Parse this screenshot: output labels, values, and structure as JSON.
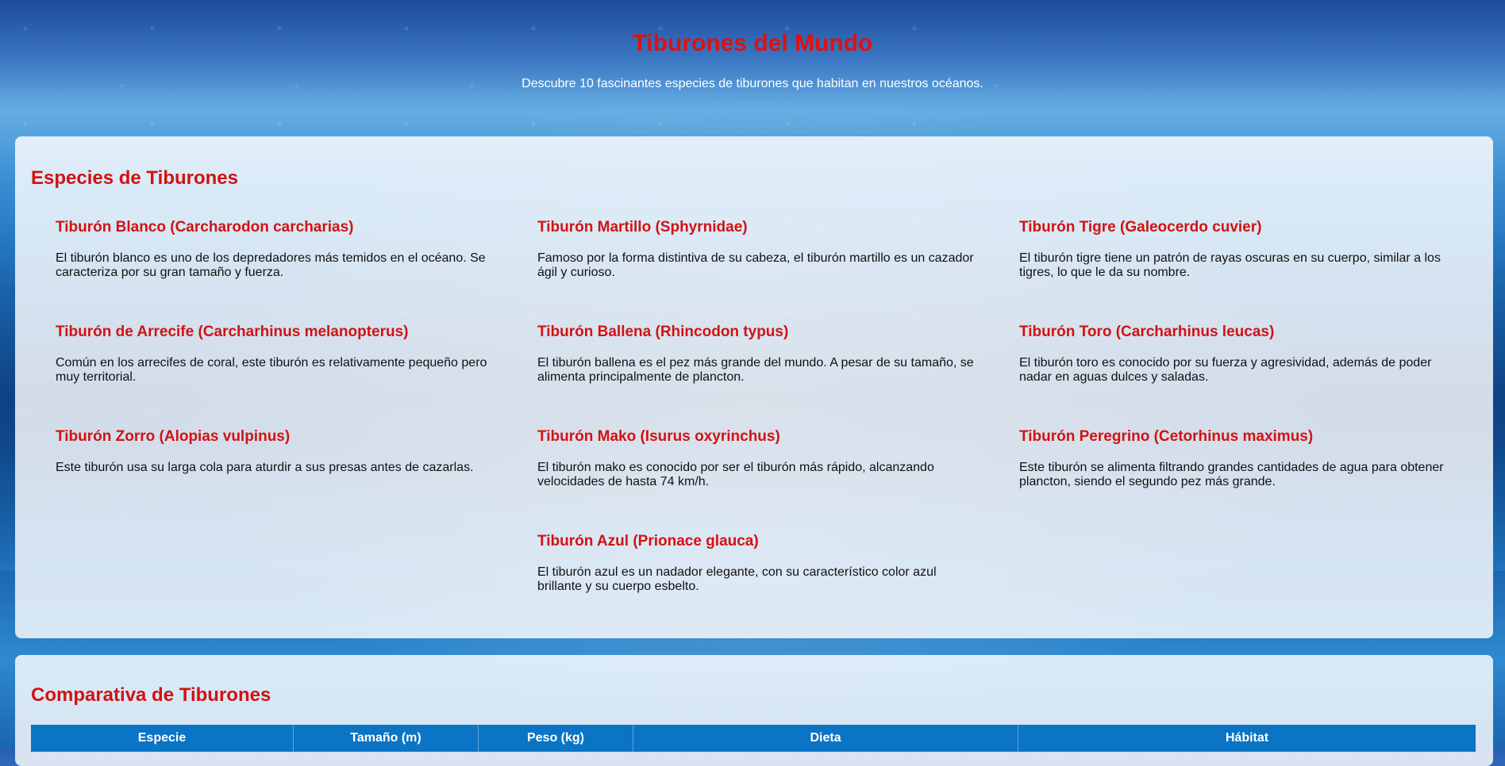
{
  "header": {
    "title": "Tiburones del Mundo",
    "subtitle": "Descubre 10 fascinantes especies de tiburones que habitan en nuestros océanos."
  },
  "species": {
    "heading": "Especies de Tiburones",
    "items": [
      {
        "name": "Tiburón Blanco (Carcharodon carcharias)",
        "desc": "El tiburón blanco es uno de los depredadores más temidos en el océano. Se caracteriza por su gran tamaño y fuerza."
      },
      {
        "name": "Tiburón Martillo (Sphyrnidae)",
        "desc": "Famoso por la forma distintiva de su cabeza, el tiburón martillo es un cazador ágil y curioso."
      },
      {
        "name": "Tiburón Tigre (Galeocerdo cuvier)",
        "desc": "El tiburón tigre tiene un patrón de rayas oscuras en su cuerpo, similar a los tigres, lo que le da su nombre."
      },
      {
        "name": "Tiburón de Arrecife (Carcharhinus melanopterus)",
        "desc": "Común en los arrecifes de coral, este tiburón es relativamente pequeño pero muy territorial."
      },
      {
        "name": "Tiburón Ballena (Rhincodon typus)",
        "desc": "El tiburón ballena es el pez más grande del mundo. A pesar de su tamaño, se alimenta principalmente de plancton."
      },
      {
        "name": "Tiburón Toro (Carcharhinus leucas)",
        "desc": "El tiburón toro es conocido por su fuerza y agresividad, además de poder nadar en aguas dulces y saladas."
      },
      {
        "name": "Tiburón Zorro (Alopias vulpinus)",
        "desc": "Este tiburón usa su larga cola para aturdir a sus presas antes de cazarlas."
      },
      {
        "name": "Tiburón Mako (Isurus oxyrinchus)",
        "desc": "El tiburón mako es conocido por ser el tiburón más rápido, alcanzando velocidades de hasta 74 km/h."
      },
      {
        "name": "Tiburón Peregrino (Cetorhinus maximus)",
        "desc": "Este tiburón se alimenta filtrando grandes cantidades de agua para obtener plancton, siendo el segundo pez más grande."
      },
      {
        "name": "Tiburón Azul (Prionace glauca)",
        "desc": "El tiburón azul es un nadador elegante, con su característico color azul brillante y su cuerpo esbelto."
      }
    ]
  },
  "comparison": {
    "heading": "Comparativa de Tiburones",
    "columns": [
      "Especie",
      "Tamaño (m)",
      "Peso (kg)",
      "Dieta",
      "Hábitat"
    ]
  },
  "colors": {
    "heading_red": "#d21212",
    "table_header_blue": "#0b74c4"
  }
}
